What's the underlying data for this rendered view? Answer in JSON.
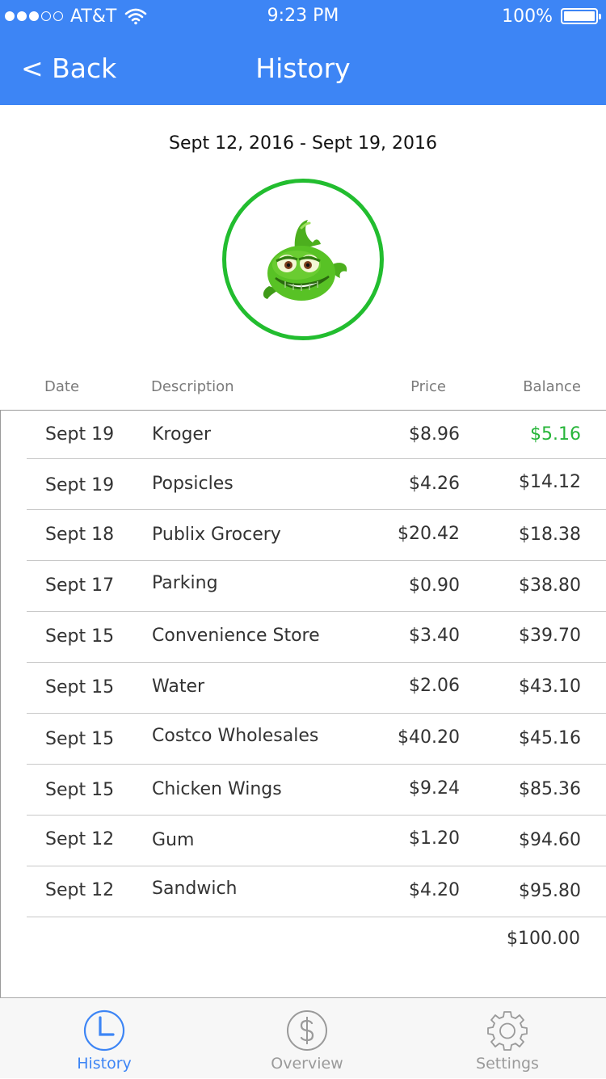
{
  "status_bar": {
    "carrier": "AT&T",
    "time": "9:23 PM",
    "battery": "100%",
    "signal_bars": 3,
    "signal_total": 5,
    "battery_level": 1.0
  },
  "nav": {
    "back_label": "< Back",
    "title": "History",
    "color": "#3d85f5"
  },
  "period": {
    "date_range": "Sept 12, 2016 - Sept 19, 2016"
  },
  "avatar": {
    "icon": "green-fish-mascot",
    "ring_color": "#22bd2f"
  },
  "table": {
    "headers": {
      "date": "Date",
      "description": "Description",
      "price": "Price",
      "balance": "Balance"
    },
    "rows": [
      {
        "date": "Sept 19",
        "description": "Kroger",
        "price": "$8.96",
        "balance": "$5.16"
      },
      {
        "date": "Sept 19",
        "description": "Popsicles",
        "price": "$4.26",
        "balance": "$14.12"
      },
      {
        "date": "Sept 18",
        "description": "Publix Grocery",
        "price": "$20.42",
        "balance": "$18.38"
      },
      {
        "date": "Sept 17",
        "description": "Parking",
        "price": "$0.90",
        "balance": "$38.80"
      },
      {
        "date": "Sept 15",
        "description": "Convenience Store",
        "price": "$3.40",
        "balance": "$39.70"
      },
      {
        "date": "Sept 15",
        "description": "Water",
        "price": "$2.06",
        "balance": "$43.10"
      },
      {
        "date": "Sept 15",
        "description": "Costco Wholesales",
        "price": "$40.20",
        "balance": "$45.16"
      },
      {
        "date": "Sept 15",
        "description": "Chicken Wings",
        "price": "$9.24",
        "balance": "$85.36"
      },
      {
        "date": "Sept 12",
        "description": "Gum",
        "price": "$1.20",
        "balance": "$94.60"
      },
      {
        "date": "Sept 12",
        "description": "Sandwich",
        "price": "$4.20",
        "balance": "$95.80"
      }
    ],
    "starting_balance": "$100.00",
    "highlight_color": "#27b53a"
  },
  "tabbar": {
    "tabs": [
      {
        "label": "History",
        "icon": "clock-icon",
        "active": true
      },
      {
        "label": "Overview",
        "icon": "dollar-coin-icon",
        "active": false
      },
      {
        "label": "Settings",
        "icon": "gear-icon",
        "active": false
      }
    ],
    "active_color": "#3d85f5",
    "inactive_color": "#9a9a9a"
  }
}
